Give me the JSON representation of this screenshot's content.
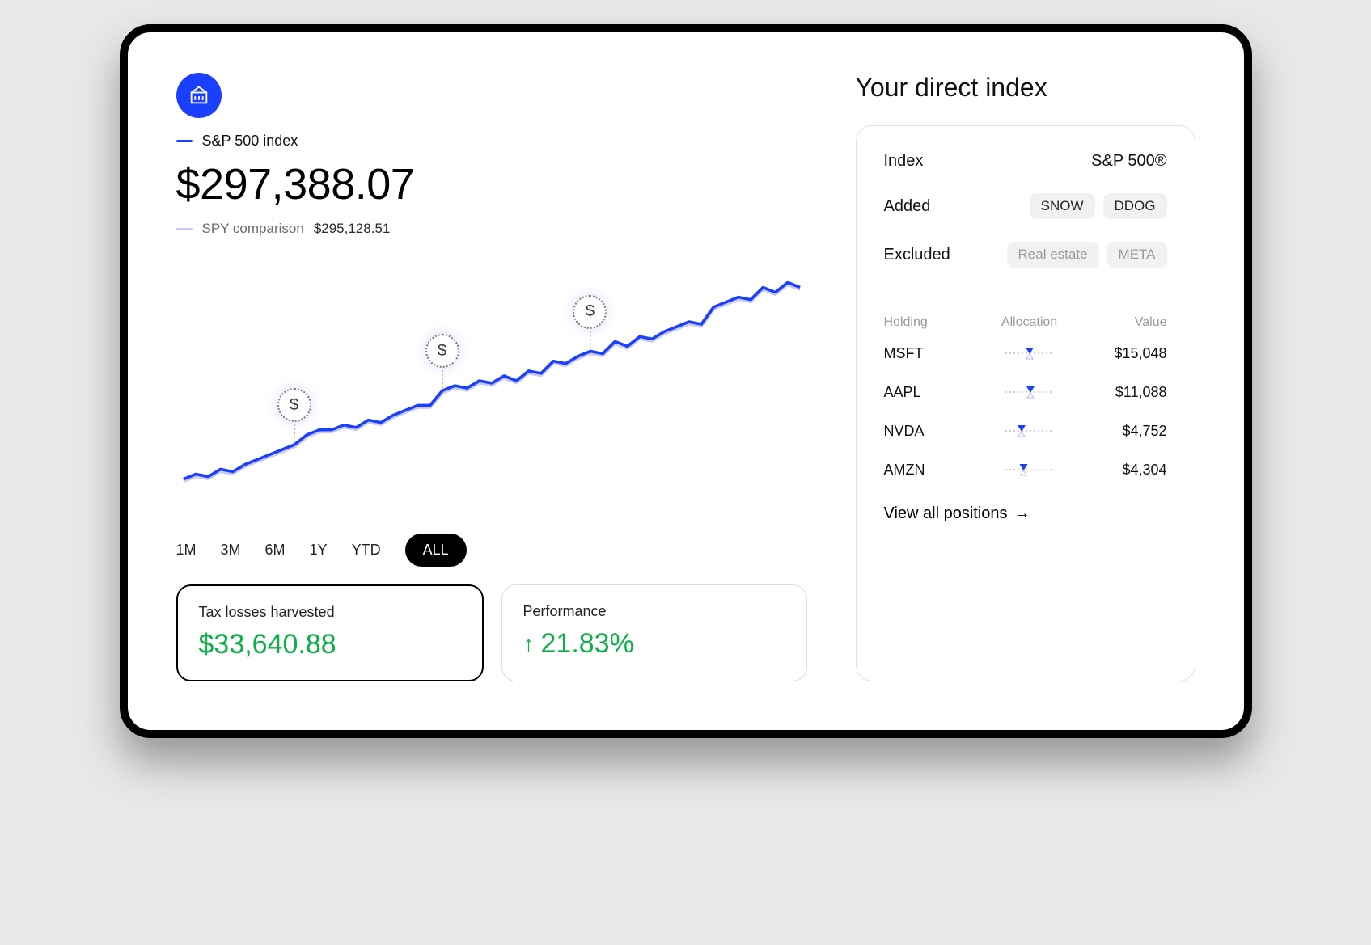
{
  "chart_data": {
    "type": "line",
    "title": "",
    "xlabel": "",
    "ylabel": "",
    "x": [
      0,
      2,
      4,
      6,
      8,
      10,
      12,
      14,
      16,
      18,
      20,
      22,
      24,
      26,
      28,
      30,
      32,
      34,
      36,
      38,
      40,
      42,
      44,
      46,
      48,
      50,
      52,
      54,
      56,
      58,
      60,
      62,
      64,
      66,
      68,
      70,
      72,
      74,
      76,
      78,
      80,
      82,
      84,
      86,
      88,
      90,
      92,
      94,
      96,
      98,
      100
    ],
    "series": [
      {
        "name": "S&P 500 index",
        "color": "#1a3fff",
        "values": [
          10,
          12,
          11,
          14,
          13,
          16,
          18,
          20,
          22,
          24,
          28,
          30,
          30,
          32,
          31,
          34,
          33,
          36,
          38,
          40,
          40,
          46,
          48,
          47,
          50,
          49,
          52,
          50,
          54,
          53,
          58,
          57,
          60,
          62,
          61,
          66,
          64,
          68,
          67,
          70,
          72,
          74,
          73,
          80,
          82,
          84,
          83,
          88,
          86,
          90,
          88
        ]
      },
      {
        "name": "SPY comparison",
        "color": "#c9caf5",
        "values": [
          9,
          11,
          10,
          13,
          12,
          15,
          17,
          19,
          21,
          23,
          27,
          29,
          29,
          31,
          30,
          33,
          32,
          35,
          37,
          39,
          39,
          45,
          47,
          46,
          49,
          48,
          51,
          49,
          53,
          52,
          57,
          56,
          59,
          61,
          60,
          65,
          63,
          67,
          66,
          69,
          71,
          73,
          72,
          79,
          81,
          83,
          82,
          87,
          85,
          89,
          87
        ]
      }
    ],
    "xlim": [
      0,
      100
    ],
    "ylim": [
      0,
      100
    ],
    "markers": [
      {
        "x": 18,
        "label": "$"
      },
      {
        "x": 42,
        "label": "$"
      },
      {
        "x": 66,
        "label": "$"
      }
    ]
  },
  "header": {
    "primary_label": "S&P 500 index",
    "primary_value": "$297,388.07",
    "secondary_label": "SPY comparison",
    "secondary_value": "$295,128.51"
  },
  "time_range": {
    "options": [
      "1M",
      "3M",
      "6M",
      "1Y",
      "YTD",
      "ALL"
    ],
    "selected": "ALL"
  },
  "cards": {
    "tax": {
      "label": "Tax losses harvested",
      "value": "$33,640.88"
    },
    "perf": {
      "label": "Performance",
      "value": "21.83%"
    }
  },
  "direct_index": {
    "title": "Your direct index",
    "index_label": "Index",
    "index_value": "S&P 500®",
    "added_label": "Added",
    "added": [
      "SNOW",
      "DDOG"
    ],
    "excluded_label": "Excluded",
    "excluded": [
      "Real estate",
      "META"
    ],
    "columns": {
      "holding": "Holding",
      "allocation": "Allocation",
      "value": "Value"
    },
    "holdings": [
      {
        "ticker": "MSFT",
        "alloc": 0.5,
        "value": "$15,048"
      },
      {
        "ticker": "AAPL",
        "alloc": 0.52,
        "value": "$11,088"
      },
      {
        "ticker": "NVDA",
        "alloc": 0.3,
        "value": "$4,752"
      },
      {
        "ticker": "AMZN",
        "alloc": 0.35,
        "value": "$4,304"
      }
    ],
    "view_all": "View all positions"
  }
}
